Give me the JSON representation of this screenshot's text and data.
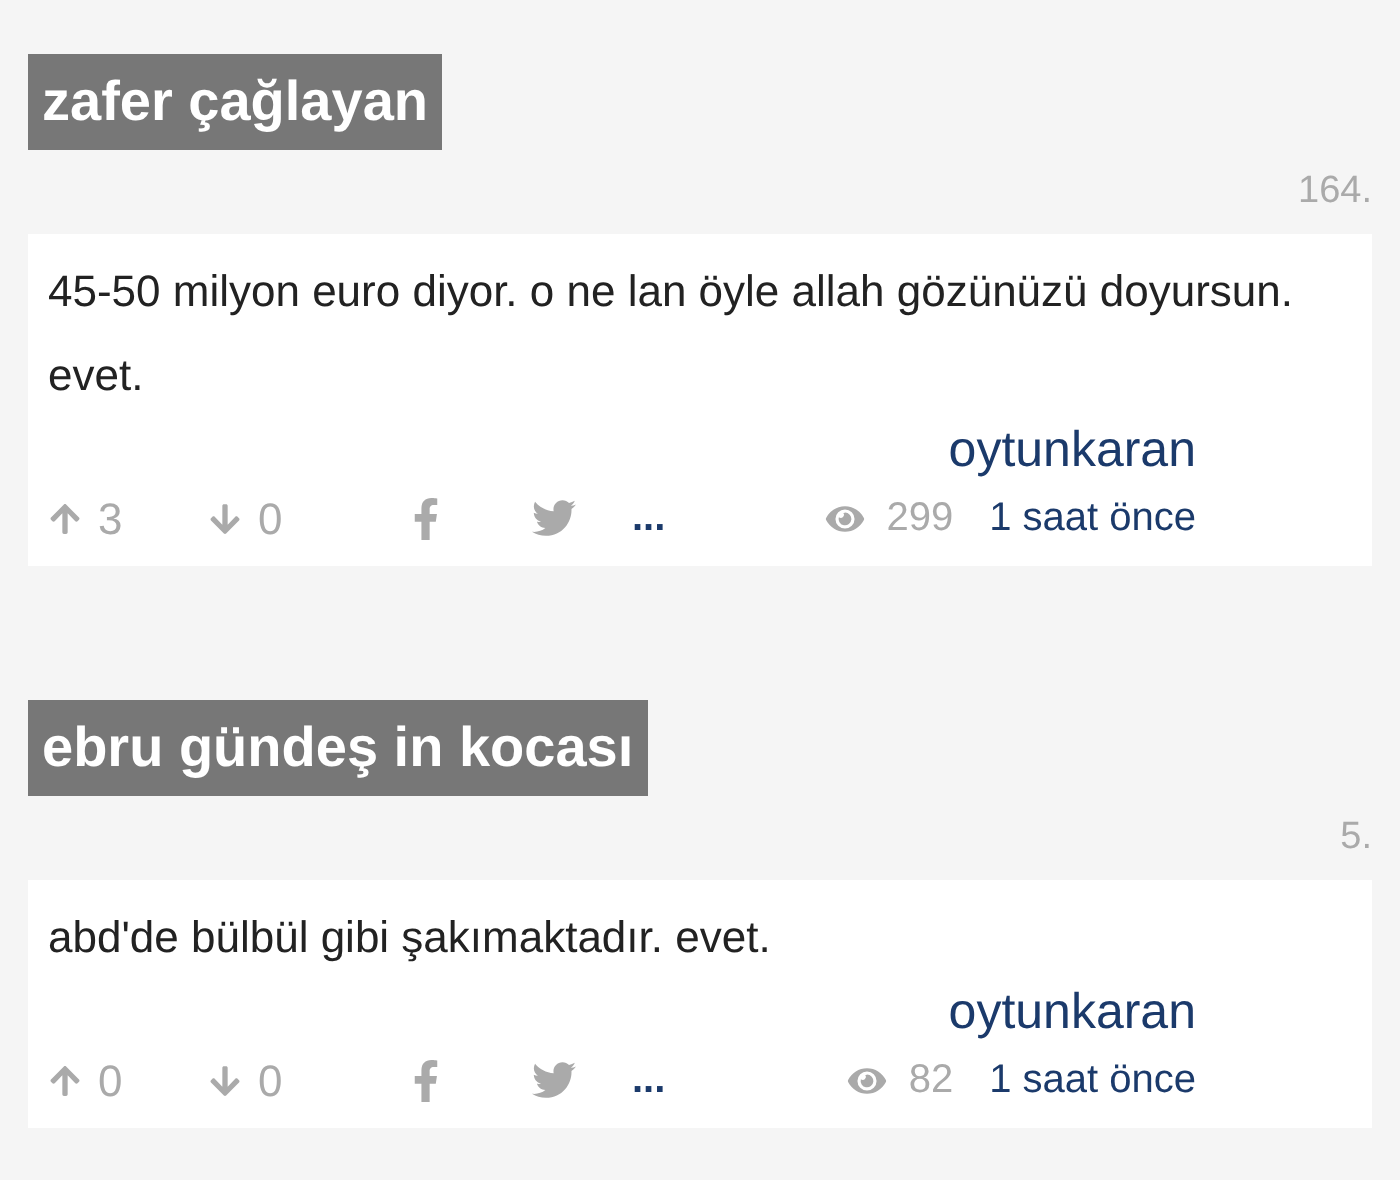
{
  "entries": [
    {
      "title": "zafer çağlayan",
      "number": "164.",
      "text": "45-50 milyon euro diyor. o ne lan öyle allah gözünüzü doyursun. evet.",
      "author": "oytunkaran",
      "upvotes": "3",
      "downvotes": "0",
      "more": "...",
      "views": "299",
      "time": "1 saat önce"
    },
    {
      "title": "ebru gündeş in kocası",
      "number": "5.",
      "text": "abd'de bülbül gibi şakımaktadır. evet.",
      "author": "oytunkaran",
      "upvotes": "0",
      "downvotes": "0",
      "more": "...",
      "views": "82",
      "time": "1 saat önce"
    }
  ]
}
